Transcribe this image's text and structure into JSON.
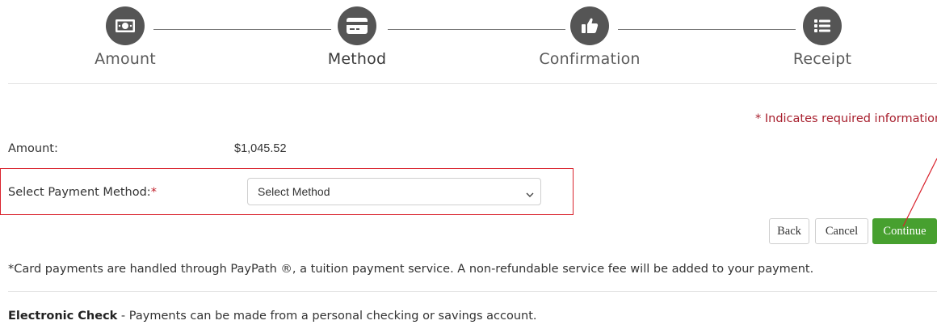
{
  "stepper": {
    "steps": [
      {
        "label": "Amount",
        "icon": "money-icon",
        "active": false
      },
      {
        "label": "Method",
        "icon": "credit-card-icon",
        "active": true
      },
      {
        "label": "Confirmation",
        "icon": "thumbs-up-icon",
        "active": false
      },
      {
        "label": "Receipt",
        "icon": "list-icon",
        "active": false
      }
    ],
    "circle_color": "#555555"
  },
  "form": {
    "required_note": "* Indicates required information",
    "amount_label": "Amount:",
    "amount_value": "$1,045.52",
    "method_label": "Select Payment Method:",
    "required_marker": "*",
    "method_select": {
      "value": "Select Method"
    }
  },
  "buttons": {
    "back": "Back",
    "cancel": "Cancel",
    "continue": "Continue",
    "continue_color": "#47a02f"
  },
  "notes": {
    "card_note": "*Card payments are handled through PayPath ®, a tuition payment service. A non-refundable service fee will be added to your payment.",
    "echeck_title": "Electronic Check",
    "echeck_text": " - Payments can be made from a personal checking or savings account."
  },
  "annotation": {
    "color": "#d9232d"
  }
}
